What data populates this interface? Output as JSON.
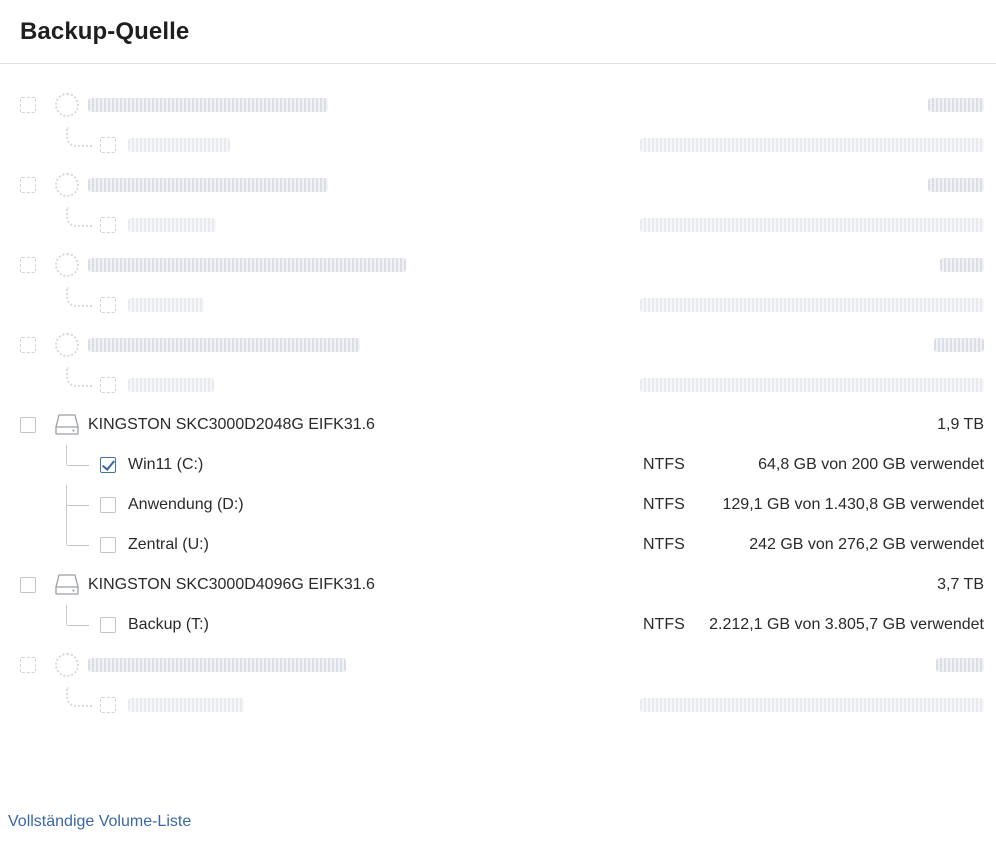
{
  "header": {
    "title": "Backup-Quelle"
  },
  "disks": [
    {
      "name": "KINGSTON SKC3000D2048G EIFK31.6",
      "size": "1,9 TB",
      "checked": false,
      "volumes": [
        {
          "label": "Win11 (C:)",
          "fs": "NTFS",
          "usage": "64,8 GB von 200 GB verwendet",
          "checked": true
        },
        {
          "label": "Anwendung (D:)",
          "fs": "NTFS",
          "usage": "129,1 GB von 1.430,8 GB verwendet",
          "checked": false
        },
        {
          "label": "Zentral (U:)",
          "fs": "NTFS",
          "usage": "242 GB von 276,2 GB verwendet",
          "checked": false
        }
      ]
    },
    {
      "name": "KINGSTON SKC3000D4096G EIFK31.6",
      "size": "3,7 TB",
      "checked": false,
      "volumes": [
        {
          "label": "Backup (T:)",
          "fs": "NTFS",
          "usage": "2.212,1 GB von 3.805,7 GB verwendet",
          "checked": false
        }
      ]
    }
  ],
  "footer": {
    "link_label": "Vollständige Volume-Liste"
  },
  "colors": {
    "accent": "#3a67a8",
    "check": "#3a62a0",
    "border": "#e3e3e3"
  }
}
